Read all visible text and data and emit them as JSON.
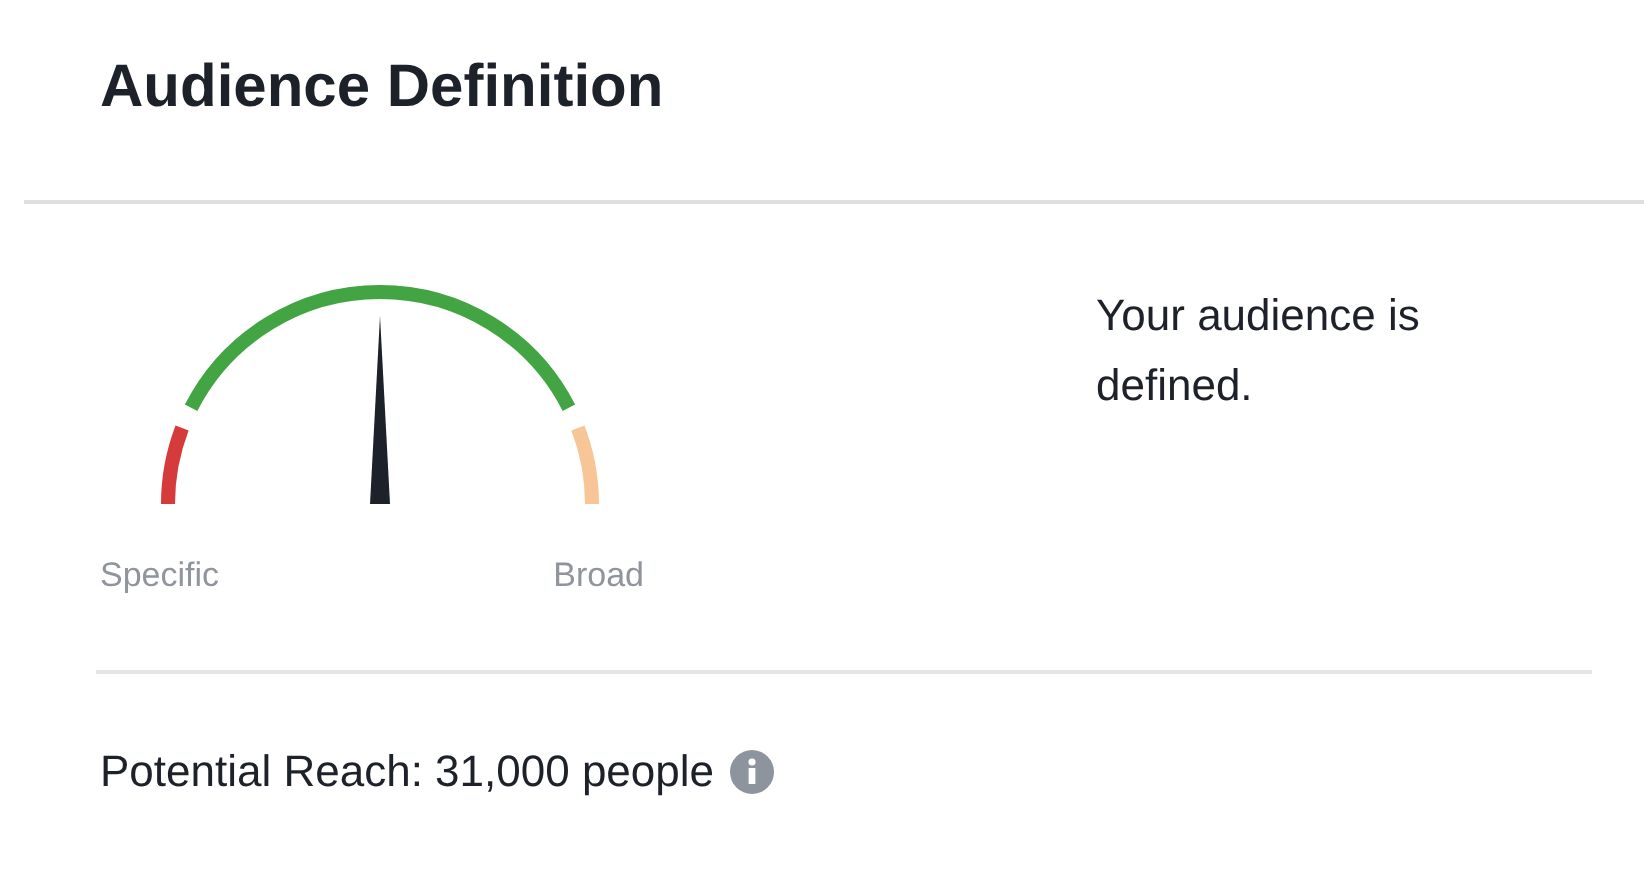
{
  "header": {
    "title": "Audience Definition"
  },
  "gauge": {
    "level": 0.5,
    "min_label": "Specific",
    "max_label": "Broad"
  },
  "status": {
    "text": "Your audience is defined."
  },
  "reach": {
    "text": "Potential Reach: 31,000 people"
  }
}
